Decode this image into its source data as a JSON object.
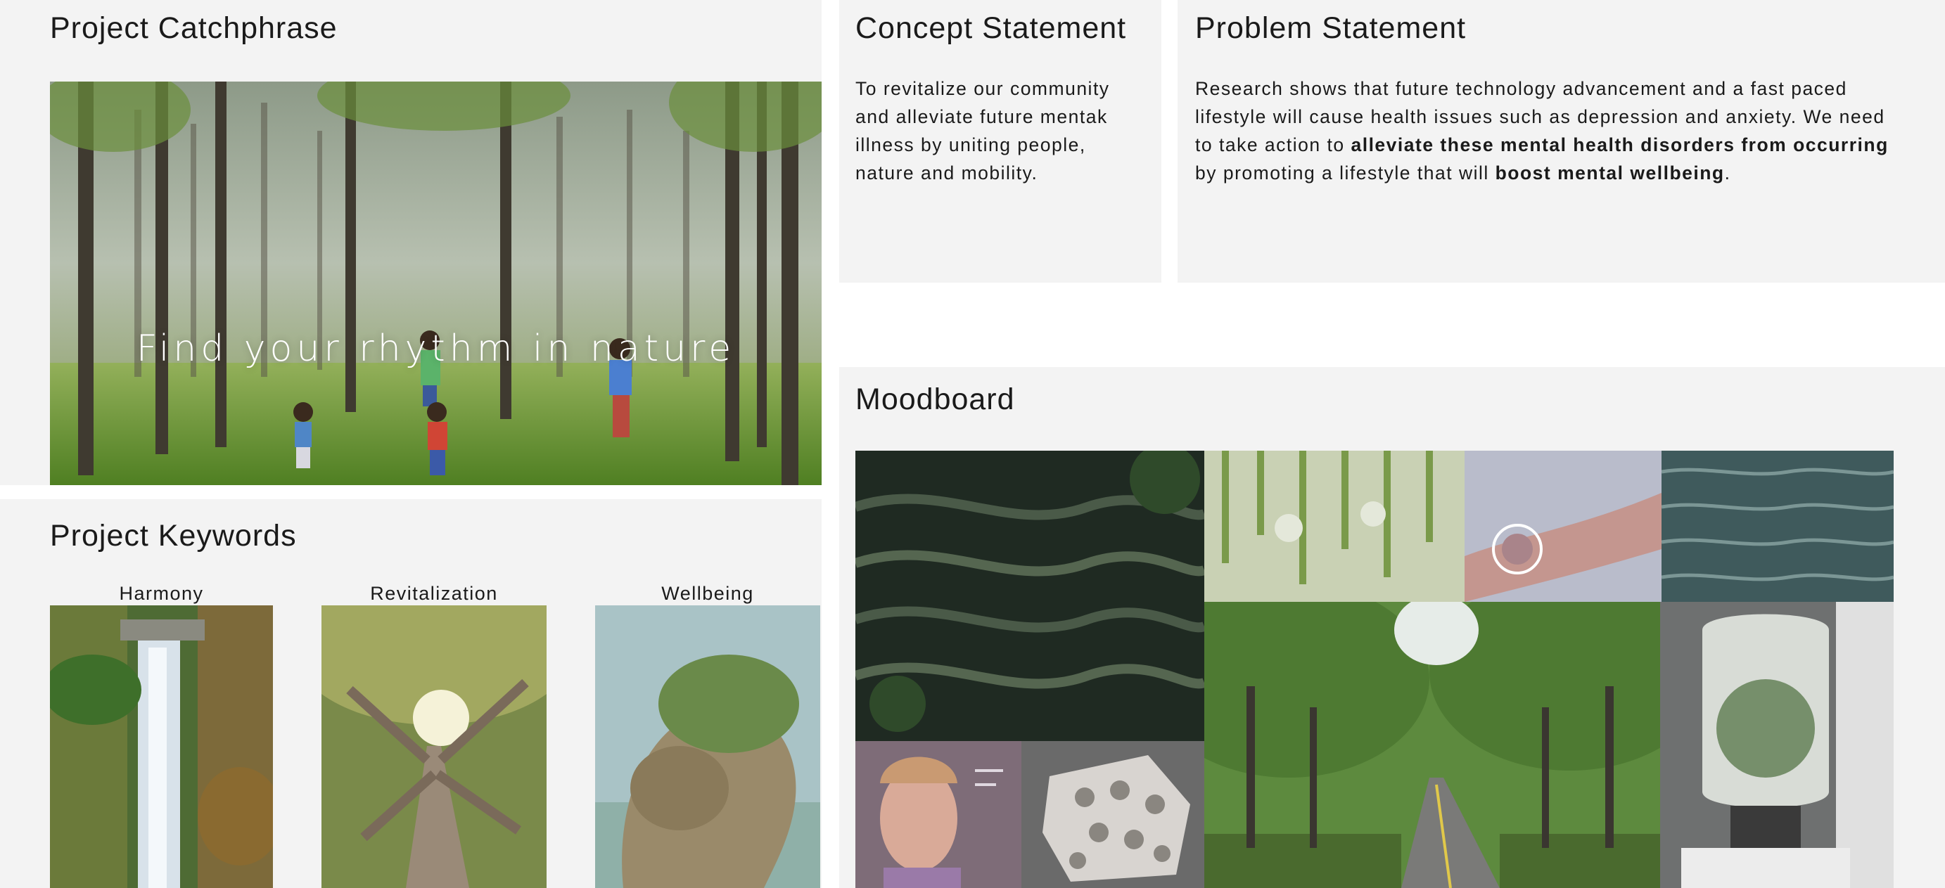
{
  "catchphrase": {
    "heading": "Project Catchphrase",
    "overlay": "Find your rhythm in nature"
  },
  "concept": {
    "heading": "Concept Statement",
    "body": "To revitalize our community and alleviate future mentak illness by uniting people, nature and mobility."
  },
  "problem": {
    "heading": "Problem Statement",
    "text_1": "Research shows that future technology advancement and a fast paced lifestyle will cause health issues such as depression and anxiety. We need to take action to ",
    "bold_1": "alleviate these mental health disorders from occurring",
    "text_2": " by promoting a lifestyle that will ",
    "bold_2": "boost mental wellbeing",
    "text_3": "."
  },
  "keywords": {
    "heading": "Project Keywords",
    "items": [
      {
        "label": "Harmony"
      },
      {
        "label": "Revitalization"
      },
      {
        "label": "Wellbeing"
      }
    ]
  },
  "moodboard": {
    "heading": "Moodboard"
  },
  "colors": {
    "panel": "#f3f3f3",
    "page": "#ffffff",
    "text": "#1a1a1a"
  }
}
